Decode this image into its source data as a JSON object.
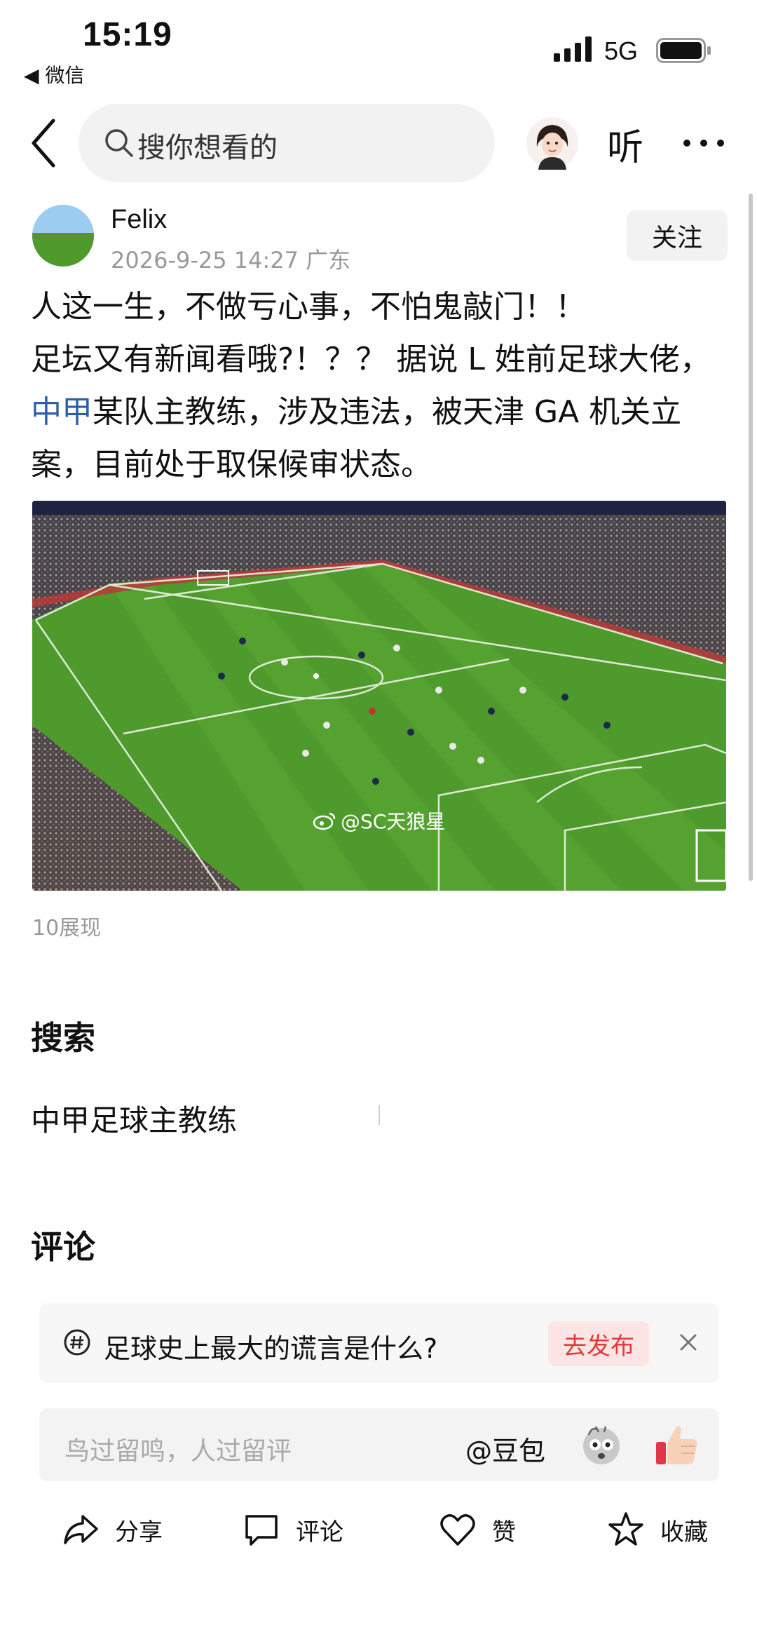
{
  "status_bar": {
    "time": "15:19",
    "back_app": "◀ 微信",
    "network": "5G",
    "icons": [
      "signal-icon",
      "battery-icon"
    ]
  },
  "nav": {
    "search_placeholder": "搜你想看的",
    "listen_label": "听",
    "icons": [
      "back-arrow-icon",
      "search-icon",
      "assistant-avatar-icon",
      "more-icon"
    ]
  },
  "post": {
    "author": "Felix",
    "meta": "2026-9-25 14:27  广东",
    "follow_label": "关注",
    "line1": "人这一生，不做亏心事，不怕鬼敲门！！",
    "line2": "足坛又有新闻看哦?！？？ 据说 L 姓前足球大佬，",
    "link_text": "中甲",
    "line3_rest": "某队主教练，涉及违法，被天津 GA 机关立",
    "line4": "案，目前处于取保候审状态。",
    "image_watermark": "@SC天狼星",
    "impressions": "10展现"
  },
  "search_section": {
    "title": "搜索",
    "suggestion": "中甲足球主教练"
  },
  "comment_section": {
    "title": "评论",
    "topic_text": "足球史上最大的谎言是什么?",
    "publish_label": "去发布",
    "input_placeholder": "鸟过留鸣，人过留评",
    "mention_label": "@豆包"
  },
  "actions": {
    "share": "分享",
    "comment": "评论",
    "like": "赞",
    "favorite": "收藏"
  },
  "colors": {
    "link": "#2f5ea8",
    "publish_text": "#e03b3b",
    "publish_bg": "#fde5e6",
    "pitch_green": "#4f9a2c"
  }
}
